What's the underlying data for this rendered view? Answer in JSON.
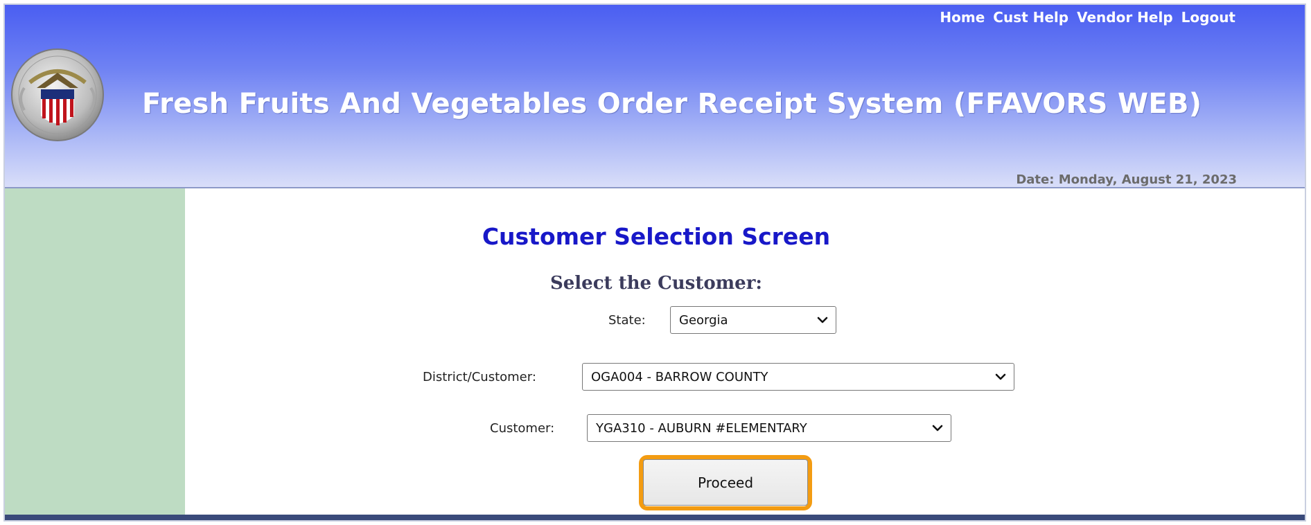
{
  "header": {
    "nav_links": [
      "Home",
      "Cust Help",
      "Vendor Help",
      "Logout"
    ],
    "app_title": "Fresh  Fruits  And  Vegetables  Order  Receipt  System (FFAVORS WEB)",
    "date": "Date: Monday, August 21, 2023",
    "seal_icon": "department-seal-icon"
  },
  "main": {
    "screen_title": "Customer Selection Screen",
    "select_heading": "Select the Customer:",
    "state": {
      "label": "State:",
      "value": "Georgia"
    },
    "district": {
      "label": "District/Customer:",
      "value": "OGA004 - BARROW COUNTY"
    },
    "customer": {
      "label": "Customer:",
      "value": "YGA310 - AUBURN #ELEMENTARY"
    },
    "proceed_label": "Proceed"
  },
  "colors": {
    "header_top": "#4a5ef2",
    "header_bottom": "#d9def9",
    "sidebar": "#bedcc3",
    "title_blue": "#1818c8",
    "highlight": "#f39c12"
  }
}
